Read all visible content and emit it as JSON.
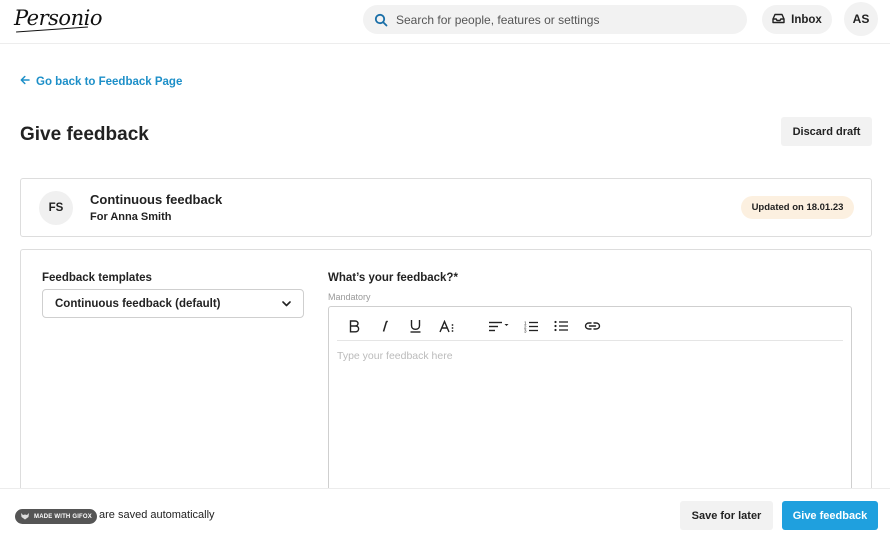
{
  "header": {
    "logo_text": "Personio",
    "search": {
      "placeholder": "Search for people, features or settings"
    },
    "inbox_label": "Inbox",
    "user_initials": "AS"
  },
  "nav": {
    "back_link": "Go back to Feedback Page"
  },
  "page": {
    "title": "Give feedback",
    "discard_label": "Discard draft"
  },
  "feedback_card": {
    "avatar_initials": "FS",
    "title": "Continuous feedback",
    "subtitle": "For Anna Smith",
    "updated_badge": "Updated on 18.01.23"
  },
  "form": {
    "templates_label": "Feedback templates",
    "template_selected": "Continuous feedback (default)",
    "feedback_label": "What’s your feedback?*",
    "mandatory_hint": "Mandatory",
    "editor_placeholder": "Type your feedback here",
    "toolbar": [
      "bold-icon",
      "italic-icon",
      "underline-icon",
      "text-size-icon",
      "align-icon",
      "ordered-list-icon",
      "bullet-list-icon",
      "link-icon"
    ]
  },
  "footer": {
    "gifox_badge": "MADE WITH GIFOX",
    "autosave_text": "are saved automatically",
    "save_later_label": "Save for later",
    "give_feedback_label": "Give feedback"
  },
  "colors": {
    "accent": "#1fa0de",
    "link": "#1d8fc8",
    "badge_bg": "#fcf0e0"
  }
}
